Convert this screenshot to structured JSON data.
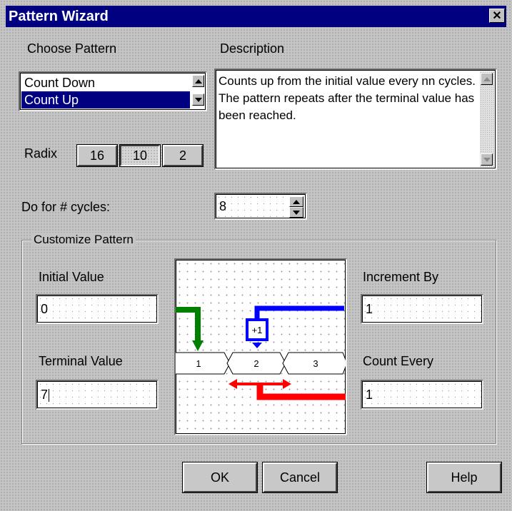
{
  "window": {
    "title": "Pattern Wizard",
    "close_glyph": "✕"
  },
  "choose_pattern": {
    "label": "Choose Pattern",
    "items": [
      {
        "label": "Count Down",
        "selected": false
      },
      {
        "label": "Count Up",
        "selected": true
      }
    ]
  },
  "description": {
    "label": "Description",
    "text": "Counts up from the initial value every nn cycles.  The pattern repeats after the terminal value has been reached."
  },
  "radix": {
    "label": "Radix",
    "options": [
      "16",
      "10",
      "2"
    ],
    "selected": "10"
  },
  "cycles": {
    "label": "Do for # cycles:",
    "value": "8"
  },
  "customize": {
    "label": "Customize Pattern",
    "initial_value": {
      "label": "Initial Value",
      "value": "0"
    },
    "terminal_value": {
      "label": "Terminal Value",
      "value": "7"
    },
    "increment_by": {
      "label": "Increment By",
      "value": "1"
    },
    "count_every": {
      "label": "Count Every",
      "value": "1"
    }
  },
  "diagram": {
    "increment_label": "+1",
    "values": [
      "1",
      "2",
      "3"
    ],
    "colors": {
      "green": "#008000",
      "blue": "#0000ff",
      "red": "#ff0000"
    }
  },
  "buttons": {
    "ok": "OK",
    "cancel": "Cancel",
    "help": "Help"
  }
}
